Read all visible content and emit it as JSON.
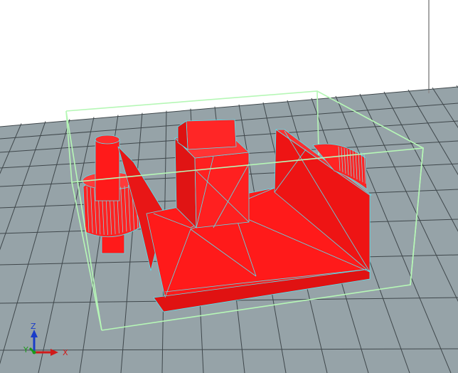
{
  "viewport": {
    "background_color": "#ffffff",
    "floor_color": "#96a3a8",
    "grid_line_color": "#3f474b",
    "back_wall_color": "#8a8a8a",
    "bounding_box_color": "#b6f7b6",
    "model_color": "#ff1a1a",
    "model_edge_color": "#56e3f0"
  },
  "axis_gizmo": {
    "z_label": "Z",
    "y_label": "Y",
    "x_label": "X",
    "z_color": "#1a3cc8",
    "x_color": "#d01a1a",
    "y_color": "#1a9a1a"
  }
}
